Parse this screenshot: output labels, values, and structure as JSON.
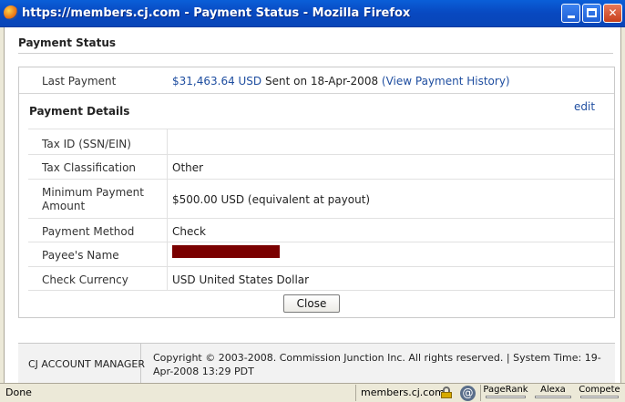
{
  "window": {
    "title": "https://members.cj.com - Payment Status - Mozilla Firefox"
  },
  "page": {
    "title": "Payment Status"
  },
  "last_payment": {
    "label": "Last Payment",
    "amount": "$31,463.64 USD",
    "sent_text": "Sent on 18-Apr-2008",
    "history_link": "(View Payment History)"
  },
  "payment_details": {
    "title": "Payment Details",
    "edit_label": "edit",
    "rows": [
      {
        "label": "Tax ID (SSN/EIN)",
        "value": ""
      },
      {
        "label": "Tax Classification",
        "value": "Other"
      },
      {
        "label": "Minimum Payment Amount",
        "value": "$500.00 USD (equivalent at payout)"
      },
      {
        "label": "Payment Method",
        "value": "Check"
      },
      {
        "label": "Payee's Name",
        "value": ""
      },
      {
        "label": "Check Currency",
        "value": "USD United States Dollar"
      }
    ],
    "redaction_color": "#7a0000"
  },
  "close_label": "Close",
  "footer": {
    "account_manager": "CJ ACCOUNT MANAGER",
    "copyright": "Copyright © 2003-2008. Commission Junction Inc. All rights reserved. | System Time: 19-Apr-2008 13:29 PDT"
  },
  "statusbar": {
    "status": "Done",
    "domain": "members.cj.com",
    "pagerank_label": "PageRank",
    "alexa_label": "Alexa",
    "compete_label": "Compete"
  }
}
